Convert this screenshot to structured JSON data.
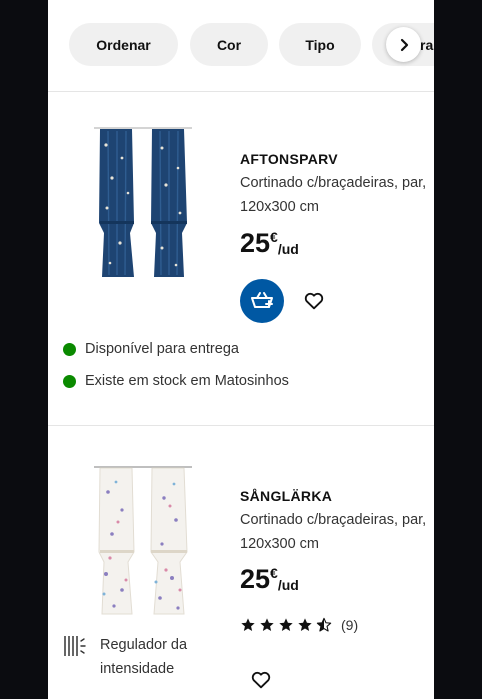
{
  "filters": {
    "items": [
      {
        "label": "Ordenar"
      },
      {
        "label": "Cor"
      },
      {
        "label": "Tipo"
      },
      {
        "label": "ra"
      }
    ]
  },
  "products": [
    {
      "name": "AFTONSPARV",
      "description": "Cortinado c/braçadeiras, par, 120x300 cm",
      "price": "25",
      "currency": "€",
      "unit": "/ud",
      "availability": [
        {
          "text": "Disponível para entrega",
          "status_color": "#0a8a00"
        },
        {
          "text": "Existe em stock em Matosinhos",
          "status_color": "#0a8a00"
        }
      ],
      "curtain_color": "#1e4472"
    },
    {
      "name": "SÅNGLÄRKA",
      "description": "Cortinado c/braçadeiras, par, 120x300 cm",
      "price": "25",
      "currency": "€",
      "unit": "/ud",
      "rating": {
        "stars": 4.5,
        "count": "(9)"
      },
      "feature": {
        "icon": "dimmer-icon",
        "text": "Regulador da intensidade"
      },
      "curtain_color": "#f4f2ee"
    }
  ],
  "colors": {
    "accent": "#0058a3",
    "in_stock": "#0a8a00",
    "chip_bg": "#f0f0f0"
  }
}
